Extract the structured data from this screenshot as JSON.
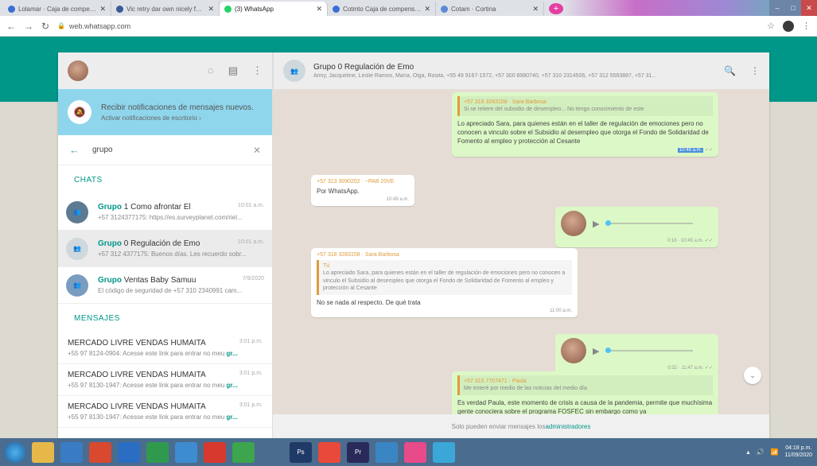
{
  "browser": {
    "tabs": [
      {
        "title": "Lolamar · Caja de compensación",
        "color": "#3b6ed6"
      },
      {
        "title": "Vic retry dar own nicely fecou",
        "color": "#3b5998"
      },
      {
        "title": "(3) WhatsApp",
        "color": "#25d366"
      },
      {
        "title": "Cotmto Caja de compensación",
        "color": "#3b6ed6"
      },
      {
        "title": "Cotam · Cortina",
        "color": "#5a8ad6"
      }
    ],
    "new_tab": "+",
    "url": "web.whatsapp.com"
  },
  "sidebar": {
    "notification": {
      "title": "Recibir notificaciones de mensajes nuevos.",
      "link": "Activar notificaciones de escritorio ›"
    },
    "search_value": "grupo",
    "chats_label": "CHATS",
    "chats": [
      {
        "name_hl": "Grupo",
        "name_rest": " 1 Como afrontar El",
        "time": "10:01 a.m.",
        "preview": "+57 3124377175: https://es.surveyplanet.com/riel...",
        "avatar_color": "#5c7a92"
      },
      {
        "name_hl": "Grupo",
        "name_rest": " 0 Regulación de Emo",
        "time": "10:01 a.m.",
        "preview": "+57 312 4377175: Buenos días. Les recuerdo sobr...",
        "avatar_color": "#cfd8dc"
      },
      {
        "name_hl": "Grupo",
        "name_rest": " Ventas Baby Samuu",
        "time": "7/9/2020",
        "preview": "El código de seguridad de +57 310 2340991 cam...",
        "avatar_color": "#7a9cc0"
      }
    ],
    "messages_label": "MENSAJES",
    "messages": [
      {
        "name": "MERCADO LIVRE VENDAS HUMAITA",
        "time": "3:01 p.m.",
        "preview": "+55 97 8124-0904: Acesse este link para entrar no meu ",
        "hl": "gr..."
      },
      {
        "name": "MERCADO LIVRE VENDAS HUMAITA",
        "time": "3:01 p.m.",
        "preview": "+55 97 8130-1947: Acesse este link para entrar no meu ",
        "hl": "gr..."
      },
      {
        "name": "MERCADO LIVRE VENDAS HUMAITA",
        "time": "3:01 p.m.",
        "preview": "+55 97 8130-1947: Acesse este link para entrar no meu ",
        "hl": "gr..."
      }
    ]
  },
  "chat": {
    "name": "Grupo 0 Regulación de Emo",
    "members": "Anny, Jacqueline, Leslie Ramos, María, Olga, Rosita, +55 49 9167-1572, +57 300 8980740, +57 310 2314506, +57 312 5563887, +57 31...",
    "bubbles": {
      "b1": {
        "quote_sender": "+57 318 3283158 · Sara Barbosa",
        "quote_text": "Si se retiere del subsidio de desempleo... No tengo conocimiento de este",
        "text": "Lo apreciado Sara, para quienes están en el taller de regulación de emociones pero no conocen a vinculo sobre el Subsidio al desempleo que otorga el Fondo de Solidaridad de Fomento al empleo y protección al Cesante",
        "time": "10:48 a.m."
      },
      "b2": {
        "sender": "+57 313 3090202 · ~PAB 20VE",
        "text": "Por WhatsApp.",
        "time": "10:49 a.m."
      },
      "b3": {
        "duration": "0:18",
        "time": "10:45 a.m."
      },
      "b4": {
        "sender": "+57 318 3283158 · Sara Barbosa",
        "quote_sender": "Tú",
        "quote_text": "Lo apreciado Sara, para quienes están en el taller de regulación de emociones pero no conocen a vinculo el Subsidio al desempleo que otorga el Fondo de Solidaridad de Fomento al empleo y protección al Cesante",
        "text": "No se nada al respecto. De qué trata",
        "time": "11:00 a.m."
      },
      "b5": {
        "duration": "0:32",
        "time": "11:47 a.m."
      },
      "b6": {
        "quote_sender": "+57 315 7707471 · Paula",
        "quote_text": "Me enteré por medio de las noticias del medio día",
        "text": "Es verdad Paula, este momento de crisis a causa de la pandemia, permite que muchísima gente conociera sobre el programa FOSFEC sin embargo como ya"
      }
    },
    "footer_pre": "Solo pueden enviar mensajes los ",
    "footer_link": "administradores"
  },
  "taskbar": {
    "time": "04:18 p.m.",
    "date": "11/09/2020",
    "apps": [
      {
        "label": "",
        "color": "#e6b84a"
      },
      {
        "label": "",
        "color": "#3a7cc4"
      },
      {
        "label": "",
        "color": "#d8492f"
      },
      {
        "label": "",
        "color": "#2a6dc2"
      },
      {
        "label": "",
        "color": "#2f9a4e"
      },
      {
        "label": "",
        "color": "#3e8cd0"
      },
      {
        "label": "",
        "color": "#d8392f"
      },
      {
        "label": "",
        "color": "#3ca54d"
      },
      {
        "label": "",
        "color": "#4a6c8e"
      },
      {
        "label": "Ps",
        "color": "#1f3a66"
      },
      {
        "label": "",
        "color": "#e8493a"
      },
      {
        "label": "Pr",
        "color": "#2a2a5a"
      },
      {
        "label": "",
        "color": "#3a86c4"
      },
      {
        "label": "",
        "color": "#e84b8a"
      },
      {
        "label": "",
        "color": "#3ba7d9"
      }
    ]
  }
}
